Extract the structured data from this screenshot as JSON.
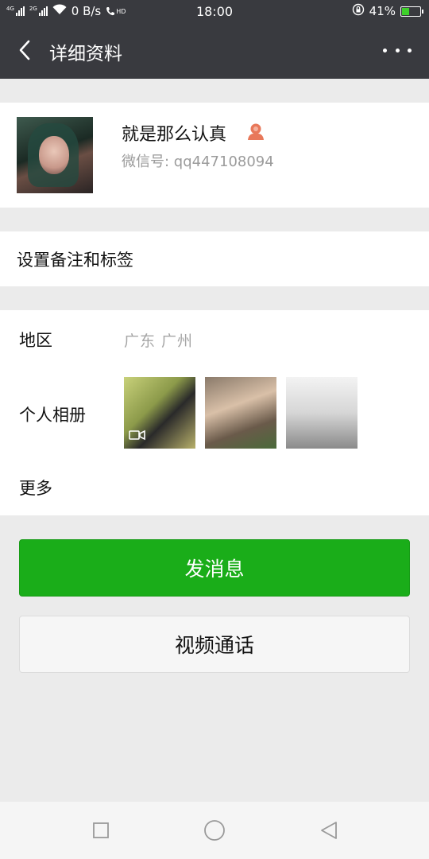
{
  "status_bar": {
    "signal1_label": "4G",
    "signal2_label": "2G",
    "speed": "0 B/s",
    "hd": "HD",
    "time": "18:00",
    "battery_percent": "41%",
    "battery_level": 0.41,
    "charging": true
  },
  "header": {
    "title": "详细资料",
    "back_icon": "chevron-left-icon",
    "more_icon": "more-dots-icon"
  },
  "profile": {
    "name": "就是那么认真",
    "wechat_id": "微信号: qq447108094",
    "contact_icon": "contact-person-icon"
  },
  "remark": {
    "label": "设置备注和标签"
  },
  "info": {
    "region_label": "地区",
    "region_value": "广东  广州",
    "album_label": "个人相册",
    "more_label": "更多"
  },
  "actions": {
    "send_label": "发消息",
    "video_call_label": "视频通话"
  },
  "colors": {
    "header_bg": "#393a3f",
    "primary_green": "#1aad19",
    "page_bg": "#ebebeb"
  }
}
